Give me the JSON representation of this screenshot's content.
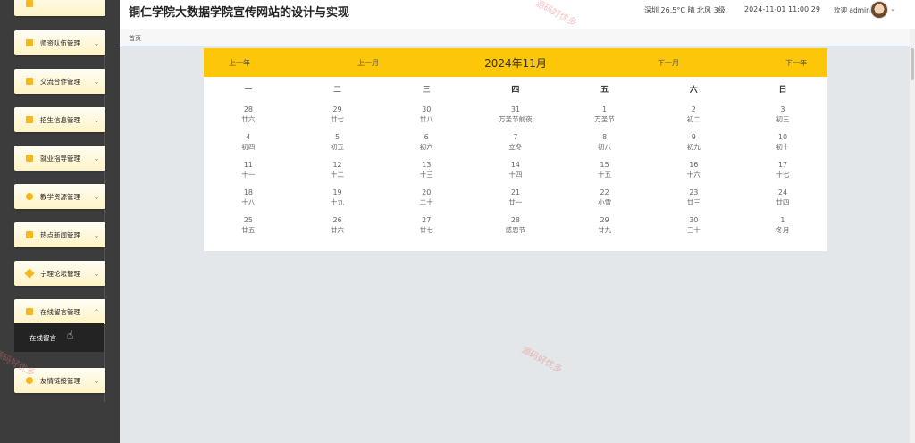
{
  "header": {
    "site_title": "铜仁学院大数据学院宣传网站的设计与实现",
    "weather": "深圳 26.5°C 晴 北风 3级",
    "datetime": "2024-11-01 11:00:29",
    "welcome": "欢迎 admin"
  },
  "breadcrumb": {
    "home": "首页"
  },
  "sidebar": {
    "items": [
      {
        "label": "师资队伍管理",
        "icon": "folder-icon"
      },
      {
        "label": "交流合作管理",
        "icon": "folder-icon"
      },
      {
        "label": "招生信息管理",
        "icon": "grid-icon"
      },
      {
        "label": "就业指导管理",
        "icon": "folder-icon"
      },
      {
        "label": "教学资源管理",
        "icon": "circle-icon"
      },
      {
        "label": "热点新闻管理",
        "icon": "folder-icon"
      },
      {
        "label": "宁理论坛管理",
        "icon": "tag-icon"
      },
      {
        "label": "在线留言管理",
        "icon": "folder-icon",
        "expanded": true
      },
      {
        "label": "友情链接管理",
        "icon": "circle-icon"
      }
    ],
    "submenu": {
      "label": "在线留言"
    }
  },
  "calendar": {
    "title": "2024年11月",
    "prev_year": "上一年",
    "prev_month": "上一月",
    "next_month": "下一月",
    "next_year": "下一年",
    "weekdays": [
      "一",
      "二",
      "三",
      "四",
      "五",
      "六",
      "日"
    ],
    "weeks": [
      [
        [
          "28",
          "廿六"
        ],
        [
          "29",
          "廿七"
        ],
        [
          "30",
          "廿八"
        ],
        [
          "31",
          "万圣节前夜"
        ],
        [
          "1",
          "万圣节"
        ],
        [
          "2",
          "初二"
        ],
        [
          "3",
          "初三"
        ]
      ],
      [
        [
          "4",
          "初四"
        ],
        [
          "5",
          "初五"
        ],
        [
          "6",
          "初六"
        ],
        [
          "7",
          "立冬"
        ],
        [
          "8",
          "初八"
        ],
        [
          "9",
          "初九"
        ],
        [
          "10",
          "初十"
        ]
      ],
      [
        [
          "11",
          "十一"
        ],
        [
          "12",
          "十二"
        ],
        [
          "13",
          "十三"
        ],
        [
          "14",
          "十四"
        ],
        [
          "15",
          "十五"
        ],
        [
          "16",
          "十六"
        ],
        [
          "17",
          "十七"
        ]
      ],
      [
        [
          "18",
          "十八"
        ],
        [
          "19",
          "十九"
        ],
        [
          "20",
          "二十"
        ],
        [
          "21",
          "廿一"
        ],
        [
          "22",
          "小雪"
        ],
        [
          "23",
          "廿三"
        ],
        [
          "24",
          "廿四"
        ]
      ],
      [
        [
          "25",
          "廿五"
        ],
        [
          "26",
          "廿六"
        ],
        [
          "27",
          "廿七"
        ],
        [
          "28",
          "感恩节"
        ],
        [
          "29",
          "廿九"
        ],
        [
          "30",
          "三十"
        ],
        [
          "1",
          "冬月"
        ]
      ]
    ]
  },
  "watermark": "源码好优多"
}
